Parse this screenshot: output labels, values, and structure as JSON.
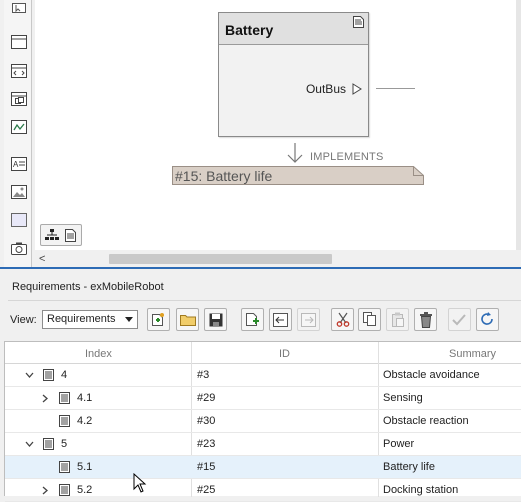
{
  "canvas": {
    "block": {
      "title": "Battery",
      "port_label": "OutBus"
    },
    "implements_label": "IMPLEMENTS",
    "requirement_note": "#15: Battery life",
    "palette_icons": [
      "area-select-icon",
      "area-icon",
      "subsystem-icon",
      "reference-icon",
      "chart-icon",
      "annotation-icon",
      "image-icon",
      "box-icon",
      "camera-icon"
    ]
  },
  "requirements": {
    "title": "Requirements - exMobileRobot",
    "view_label": "View:",
    "view_value": "Requirements",
    "columns": {
      "index": "Index",
      "id": "ID",
      "summary": "Summary"
    },
    "rows": [
      {
        "index": "4",
        "id": "#3",
        "summary": "Obstacle avoidance",
        "level": 0,
        "expander": "expanded"
      },
      {
        "index": "4.1",
        "id": "#29",
        "summary": "Sensing",
        "level": 1,
        "expander": "collapsed"
      },
      {
        "index": "4.2",
        "id": "#30",
        "summary": "Obstacle reaction",
        "level": 1,
        "expander": "none"
      },
      {
        "index": "5",
        "id": "#23",
        "summary": "Power",
        "level": 0,
        "expander": "expanded"
      },
      {
        "index": "5.1",
        "id": "#15",
        "summary": "Battery life",
        "level": 1,
        "expander": "none",
        "selected": true
      },
      {
        "index": "5.2",
        "id": "#25",
        "summary": "Docking station",
        "level": 1,
        "expander": "collapsed"
      }
    ]
  },
  "colors": {
    "accent": "#2d6bb5",
    "selection": "#e5f1fb",
    "cut_red": "#c0392b"
  }
}
